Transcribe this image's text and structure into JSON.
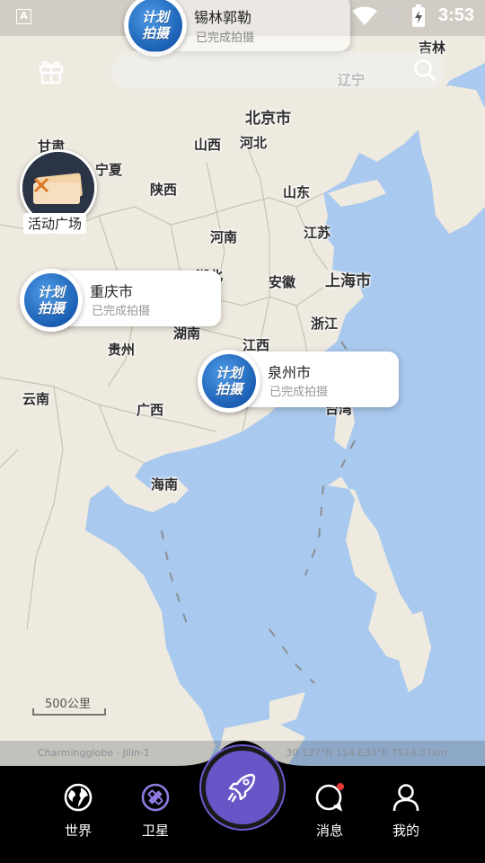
{
  "status_bar": {
    "time": "3:53",
    "app_indicator": "A"
  },
  "search": {
    "placeholder": "",
    "value": ""
  },
  "map_labels": {
    "jilin": "吉林",
    "liaoning": "辽宁",
    "beijing": "北京市",
    "shanxi": "山西",
    "hebei": "河北",
    "gansu": "甘肃",
    "ningxia": "宁夏",
    "shaanxi": "陕西",
    "shandong": "山东",
    "henan": "河南",
    "jiangsu": "江苏",
    "anhui": "安徽",
    "shanghai": "上海市",
    "hubei": "湖北",
    "zhejiang": "浙江",
    "guizhou": "贵州",
    "hunan": "湖南",
    "jiangxi": "江西",
    "yunnan": "云南",
    "guangxi": "广西",
    "taiwan": "台湾",
    "hainan": "海南"
  },
  "activity": {
    "label": "活动广场",
    "icon": "ticket-icon"
  },
  "plan_badge": {
    "line1": "计划",
    "line2": "拍摄"
  },
  "cards": [
    {
      "city": "锡林郭勒",
      "status": "已完成拍摄"
    },
    {
      "city": "重庆市",
      "status": "已完成拍摄"
    },
    {
      "city": "泉州市",
      "status": "已完成拍摄"
    }
  ],
  "scale": {
    "label": "500公里"
  },
  "attribution": {
    "left": "Charmingglobe · Jilin-1",
    "right": "30.137°N 114.633°E 7514.07km"
  },
  "nav": [
    {
      "label": "世界",
      "icon": "globe-icon"
    },
    {
      "label": "卫星",
      "icon": "satellite-icon"
    },
    {
      "label": "",
      "icon": "rocket-icon"
    },
    {
      "label": "消息",
      "icon": "message-icon"
    },
    {
      "label": "我的",
      "icon": "user-icon"
    }
  ],
  "colors": {
    "accent": "#6a55c8",
    "sea": "#a9c9ee",
    "land": "#efeae0",
    "notification_dot": "#e53935"
  }
}
